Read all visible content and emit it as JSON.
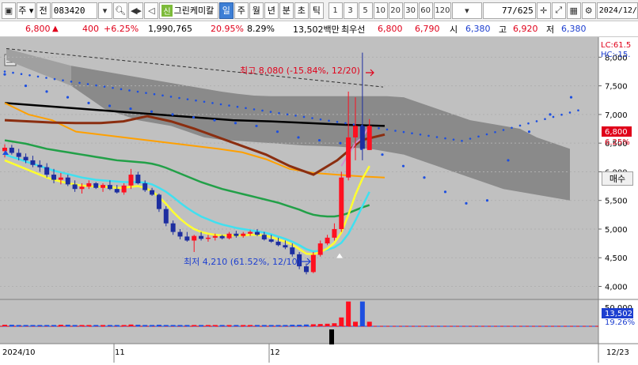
{
  "toolbar": {
    "market": "주",
    "type": "전",
    "code": "083420",
    "badge": "신",
    "name": "그린케미칼",
    "periods": [
      "일",
      "주",
      "월",
      "년",
      "분",
      "초",
      "틱"
    ],
    "selected_period": "일",
    "numbers": [
      "1",
      "3",
      "5",
      "10",
      "20",
      "30",
      "60",
      "120"
    ],
    "count": "77/625",
    "date": "2024/12/"
  },
  "quote": {
    "price": "6,800",
    "change": "400",
    "change_pct": "+6.25%",
    "volume": "1,990,765",
    "turnover": "20.95%",
    "ratio": "8.29%",
    "amount": "13,502백만",
    "best_label": "최우선",
    "best_ask": "6,800",
    "best_bid": "6,790",
    "open_label": "시",
    "open": "6,380",
    "high_label": "고",
    "high": "6,920",
    "low_label": "저",
    "low": "6,380"
  },
  "chart_data": {
    "type": "candlestick",
    "x_labels": [
      "2024/10",
      "11",
      "12",
      "12/23"
    ],
    "y_ticks": [
      4000,
      4500,
      5000,
      5500,
      6000,
      6500,
      7000,
      7500,
      8000
    ],
    "ylim": [
      3800,
      8350
    ],
    "candles": [
      [
        6360,
        6480,
        6250,
        6420
      ],
      [
        6420,
        6470,
        6300,
        6330
      ],
      [
        6330,
        6400,
        6200,
        6260
      ],
      [
        6260,
        6320,
        6150,
        6200
      ],
      [
        6200,
        6280,
        6080,
        6120
      ],
      [
        6120,
        6200,
        6000,
        6080
      ],
      [
        6080,
        6150,
        5900,
        5950
      ],
      [
        5950,
        6050,
        5800,
        5860
      ],
      [
        5860,
        5980,
        5780,
        5900
      ],
      [
        5900,
        5950,
        5750,
        5780
      ],
      [
        5780,
        5850,
        5650,
        5700
      ],
      [
        5700,
        5800,
        5620,
        5740
      ],
      [
        5740,
        5850,
        5700,
        5800
      ],
      [
        5800,
        5820,
        5700,
        5720
      ],
      [
        5720,
        5800,
        5650,
        5770
      ],
      [
        5770,
        5850,
        5680,
        5700
      ],
      [
        5700,
        5770,
        5620,
        5640
      ],
      [
        5640,
        5800,
        5600,
        5760
      ],
      [
        5760,
        6050,
        5700,
        5950
      ],
      [
        5950,
        6000,
        5780,
        5800
      ],
      [
        5800,
        5850,
        5650,
        5680
      ],
      [
        5680,
        5720,
        5580,
        5600
      ],
      [
        5600,
        5620,
        5300,
        5350
      ],
      [
        5350,
        5400,
        5050,
        5100
      ],
      [
        5100,
        5150,
        4900,
        4950
      ],
      [
        4950,
        5000,
        4820,
        4870
      ],
      [
        4870,
        4950,
        4780,
        4800
      ],
      [
        4800,
        4900,
        4600,
        4880
      ],
      [
        4880,
        4950,
        4800,
        4830
      ],
      [
        4830,
        4900,
        4780,
        4850
      ],
      [
        4850,
        4920,
        4800,
        4880
      ],
      [
        4880,
        4900,
        4820,
        4840
      ],
      [
        4840,
        4950,
        4820,
        4920
      ],
      [
        4920,
        4970,
        4850,
        4880
      ],
      [
        4880,
        4950,
        4850,
        4920
      ],
      [
        4920,
        4980,
        4880,
        4950
      ],
      [
        4950,
        5000,
        4880,
        4900
      ],
      [
        4900,
        4950,
        4800,
        4820
      ],
      [
        4820,
        4900,
        4760,
        4780
      ],
      [
        4780,
        4850,
        4700,
        4720
      ],
      [
        4720,
        4800,
        4650,
        4680
      ],
      [
        4680,
        4750,
        4520,
        4560
      ],
      [
        4560,
        4600,
        4300,
        4350
      ],
      [
        4350,
        4400,
        4210,
        4250
      ],
      [
        4250,
        4600,
        4230,
        4550
      ],
      [
        4550,
        4800,
        4520,
        4750
      ],
      [
        4750,
        4900,
        4720,
        4850
      ],
      [
        4850,
        5100,
        4800,
        5000
      ],
      [
        5000,
        6000,
        4950,
        5900
      ],
      [
        5900,
        7400,
        5850,
        6600
      ],
      [
        6600,
        7300,
        6200,
        6800
      ],
      [
        6800,
        8080,
        6200,
        6400
      ],
      [
        6380,
        6920,
        6380,
        6800
      ]
    ],
    "ma_short": [
      6200,
      6150,
      6100,
      6050,
      6000,
      5950,
      5900,
      5860,
      5830,
      5800,
      5780,
      5760,
      5750,
      5740,
      5740,
      5730,
      5720,
      5720,
      5740,
      5750,
      5720,
      5660,
      5560,
      5440,
      5300,
      5180,
      5080,
      5000,
      4950,
      4920,
      4900,
      4890,
      4890,
      4890,
      4890,
      4900,
      4900,
      4890,
      4860,
      4820,
      4780,
      4730,
      4650,
      4570,
      4560,
      4600,
      4660,
      4760,
      4940,
      5250,
      5600,
      5880,
      6100
    ],
    "ma_mid": [
      6300,
      6260,
      6220,
      6180,
      6140,
      6100,
      6060,
      6020,
      5990,
      5960,
      5930,
      5900,
      5880,
      5860,
      5850,
      5840,
      5830,
      5820,
      5820,
      5820,
      5810,
      5780,
      5720,
      5650,
      5560,
      5460,
      5370,
      5290,
      5220,
      5170,
      5120,
      5080,
      5050,
      5020,
      5000,
      4980,
      4960,
      4940,
      4910,
      4870,
      4830,
      4780,
      4720,
      4650,
      4610,
      4620,
      4640,
      4680,
      4760,
      4920,
      5150,
      5400,
      5650
    ],
    "ma_long": [
      6550,
      6530,
      6510,
      6490,
      6460,
      6430,
      6400,
      6380,
      6360,
      6340,
      6320,
      6300,
      6280,
      6260,
      6240,
      6220,
      6200,
      6190,
      6180,
      6170,
      6160,
      6140,
      6110,
      6070,
      6020,
      5970,
      5920,
      5870,
      5820,
      5780,
      5740,
      5700,
      5670,
      5640,
      5610,
      5580,
      5550,
      5520,
      5490,
      5460,
      5420,
      5380,
      5340,
      5290,
      5250,
      5230,
      5220,
      5220,
      5240,
      5280,
      5330,
      5380,
      5420
    ],
    "ma_orange": [
      7200,
      7000,
      6900,
      6700,
      6650,
      6600,
      6550,
      6500,
      6450,
      6400,
      6340,
      6220,
      6050,
      5980,
      5950,
      5920,
      5900
    ],
    "ma_brown": [
      6900,
      6880,
      6860,
      6850,
      6850,
      6880,
      6970,
      6880,
      6750,
      6600,
      6450,
      6300,
      6100,
      5950,
      6200,
      6550,
      6650
    ],
    "ma_black": [
      7200,
      7150,
      7100,
      7050,
      7000,
      6950,
      6900,
      6880,
      6850,
      6820,
      6800
    ],
    "ichimoku_points": [
      7700,
      7500,
      7400,
      7300,
      7200,
      7150,
      7100,
      7050,
      7000,
      6950,
      6900,
      6850,
      6800,
      6700,
      6600,
      6550,
      6500,
      6400,
      6300,
      6100,
      5900,
      5650,
      5450,
      5500,
      6200,
      6700,
      7000,
      7300
    ],
    "volume": [
      0.06,
      0.06,
      0.05,
      0.05,
      0.05,
      0.05,
      0.05,
      0.05,
      0.06,
      0.06,
      0.05,
      0.05,
      0.05,
      0.05,
      0.05,
      0.05,
      0.05,
      0.05,
      0.07,
      0.06,
      0.05,
      0.05,
      0.06,
      0.05,
      0.05,
      0.05,
      0.05,
      0.05,
      0.05,
      0.05,
      0.05,
      0.05,
      0.05,
      0.05,
      0.05,
      0.05,
      0.05,
      0.05,
      0.05,
      0.05,
      0.05,
      0.06,
      0.06,
      0.07,
      0.08,
      0.09,
      0.1,
      0.12,
      0.35,
      0.98,
      0.18,
      0.98,
      0.18
    ],
    "annotations": {
      "high_text": "최고 8,080 (-15.84%, 12/20)",
      "low_text": "최저 4,210 (61.52%, 12/10)"
    },
    "right_labels": {
      "lc": "LC:61.5",
      "hc": "HC:-15.",
      "price_box": "6,800",
      "pct": "6.25%",
      "volume_top": "50,000",
      "volume_box": "13,502",
      "volume_pct": "19.26%",
      "button": "매수"
    }
  }
}
